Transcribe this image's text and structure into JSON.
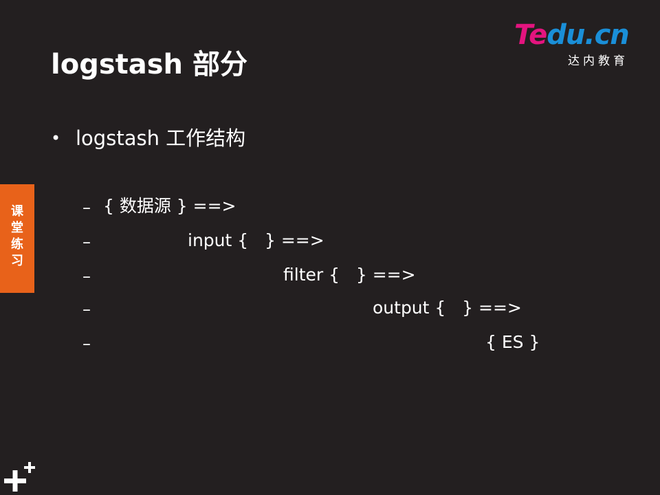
{
  "logo": {
    "brand_part1": "Te",
    "brand_part2": "du.cn",
    "subtitle": "达内教育"
  },
  "slide": {
    "title": "logstash 部分",
    "bullet": {
      "marker": "•",
      "text": "logstash  工作结构"
    },
    "sub_items": [
      {
        "dash": "–",
        "text": "{ 数据源 } ==>"
      },
      {
        "dash": "–",
        "text": "input {   } ==>"
      },
      {
        "dash": "–",
        "text": "filter {   } ==>"
      },
      {
        "dash": "–",
        "text": "output {   } ==>"
      },
      {
        "dash": "–",
        "text": "{ ES }"
      }
    ]
  },
  "side_tab": {
    "text": "课堂练习"
  },
  "colors": {
    "background": "#231f20",
    "accent_orange": "#e8621a",
    "logo_pink": "#e4147f",
    "logo_blue": "#1a8fd8"
  }
}
